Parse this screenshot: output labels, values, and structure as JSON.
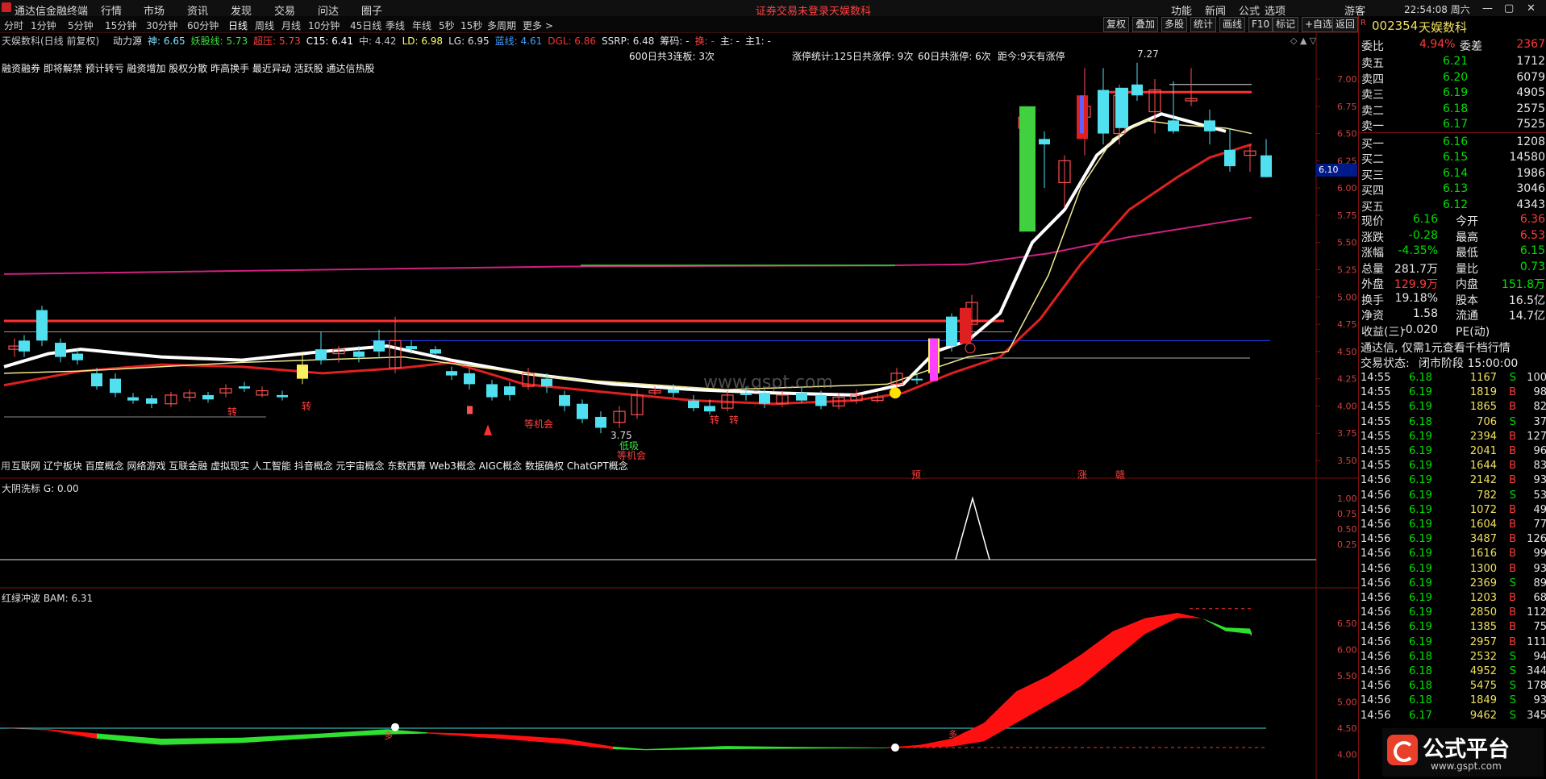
{
  "topbar": {
    "app_title": "通达信金融终端",
    "menu": [
      "行情",
      "市场",
      "资讯",
      "发现",
      "交易",
      "问达",
      "圈子"
    ],
    "status_notice": "证券交易未登录",
    "stock_name_top": "天娱数科",
    "right_menu": [
      "功能",
      "新闻",
      "公式",
      "选项"
    ],
    "user": "游客",
    "clock": "22:54:08 周六"
  },
  "periodbar": {
    "periods": [
      "分时",
      "1分钟",
      "5分钟",
      "15分钟",
      "30分钟",
      "60分钟",
      "日线",
      "周线",
      "月线",
      "10分钟",
      "45日线",
      "季线",
      "年线",
      "5秒",
      "15秒",
      "多周期",
      "更多 >"
    ],
    "active": "日线",
    "tools": [
      "复权",
      "叠加",
      "多股",
      "统计",
      "画线",
      "F10",
      "标记",
      "+自选",
      "返回"
    ]
  },
  "indicator_line": {
    "title": "天娱数科(日线 前复权)",
    "items": [
      {
        "text": "动力源",
        "color": "#e0e0e0"
      },
      {
        "text": "神: 6.65",
        "color": "#7fe0ff"
      },
      {
        "text": "妖股线: 5.73",
        "color": "#40e040"
      },
      {
        "text": "超压: 5.73",
        "color": "#ff4040"
      },
      {
        "text": "C15: 6.41",
        "color": "#ffffff"
      },
      {
        "text": "中: 4.42",
        "color": "#c0c0c0"
      },
      {
        "text": "LD: 6.98",
        "color": "#ffff60"
      },
      {
        "text": "LG: 6.95",
        "color": "#e0e0e0"
      },
      {
        "text": "蓝线: 4.61",
        "color": "#40a0ff"
      },
      {
        "text": "DGL: 6.86",
        "color": "#ff3030"
      },
      {
        "text": "SSRP: 6.48",
        "color": "#e0e0e0"
      },
      {
        "text": "筹码: -",
        "color": "#e0e0e0"
      },
      {
        "text": "换: -",
        "color": "#ff4040"
      },
      {
        "text": "主: -",
        "color": "#e0e0e0"
      },
      {
        "text": "主1: -",
        "color": "#e0e0e0"
      }
    ]
  },
  "tags_line": "融资融券 即将解禁 预计转亏 融资增加 股权分散 昨高换手 最近异动 活跃股 通达信热股",
  "concept_line": "互联网 辽宁板块 百度概念 网络游戏 互联金融 虚拟现实 人工智能 抖音概念 元宇宙概念 东数西算 Web3概念 AIGC概念 数据确权 ChatGPT概念",
  "concept_prefix": "用",
  "stats": {
    "s1": "600日共3连板: 3次",
    "s2": "涨停统计:125日共涨停: 9次",
    "s3": "60日共涨停: 6次",
    "s4": "距今:9天有涨停"
  },
  "main_chart": {
    "y_ticks": [
      "7.00",
      "6.75",
      "6.50",
      "6.25",
      "6.00",
      "5.75",
      "5.50",
      "5.25",
      "5.00",
      "4.75",
      "4.50",
      "4.25",
      "4.00",
      "3.75",
      "3.50"
    ],
    "price_box": "6.10",
    "high_label": "7.27",
    "low_label": "3.75",
    "annotations": {
      "zhuan": "转",
      "dengjihui": "等机会",
      "diqi": "低吸",
      "yu": "预",
      "zhang": "涨",
      "zhu": "赣"
    },
    "watermark": "www.gspt.com"
  },
  "panel2": {
    "title": "大阴洗标 G: 0.00",
    "y_ticks": [
      "1.00",
      "0.75",
      "0.50",
      "0.25"
    ]
  },
  "panel3": {
    "title": "红绿冲波 BAM: 6.31",
    "y_ticks": [
      "6.50",
      "6.00",
      "5.50",
      "5.00",
      "4.50",
      "4.00"
    ],
    "marker": "多"
  },
  "right": {
    "code": "002354",
    "name": "天娱数科",
    "weibi_label": "委比",
    "weibi": "4.94%",
    "weicha_label": "委差",
    "weicha": "2367",
    "sells": [
      {
        "label": "卖五",
        "price": "6.21",
        "vol": "1712"
      },
      {
        "label": "卖四",
        "price": "6.20",
        "vol": "6079"
      },
      {
        "label": "卖三",
        "price": "6.19",
        "vol": "4905"
      },
      {
        "label": "卖二",
        "price": "6.18",
        "vol": "2575"
      },
      {
        "label": "卖一",
        "price": "6.17",
        "vol": "7525"
      }
    ],
    "buys": [
      {
        "label": "买一",
        "price": "6.16",
        "vol": "1208"
      },
      {
        "label": "买二",
        "price": "6.15",
        "vol": "14580"
      },
      {
        "label": "买三",
        "price": "6.14",
        "vol": "1986"
      },
      {
        "label": "买四",
        "price": "6.13",
        "vol": "3046"
      },
      {
        "label": "买五",
        "price": "6.12",
        "vol": "4343"
      }
    ],
    "quotes": [
      {
        "l1": "现价",
        "v1": "6.16",
        "c1": "green",
        "l2": "今开",
        "v2": "6.36",
        "c2": "red"
      },
      {
        "l1": "涨跌",
        "v1": "-0.28",
        "c1": "green",
        "l2": "最高",
        "v2": "6.53",
        "c2": "red"
      },
      {
        "l1": "涨幅",
        "v1": "-4.35%",
        "c1": "green",
        "l2": "最低",
        "v2": "6.15",
        "c2": "green"
      },
      {
        "l1": "总量",
        "v1": "281.7万",
        "c1": "white",
        "l2": "量比",
        "v2": "0.73",
        "c2": "green"
      },
      {
        "l1": "外盘",
        "v1": "129.9万",
        "c1": "red",
        "l2": "内盘",
        "v2": "151.8万",
        "c2": "green"
      },
      {
        "l1": "换手",
        "v1": "19.18%",
        "c1": "white",
        "l2": "股本",
        "v2": "16.5亿",
        "c2": "white"
      },
      {
        "l1": "净资",
        "v1": "1.58",
        "c1": "white",
        "l2": "流通",
        "v2": "14.7亿",
        "c2": "white"
      },
      {
        "l1": "收益(三)",
        "v1": "-0.020",
        "c1": "white",
        "l2": "PE(动)",
        "v2": "",
        "c2": "white"
      }
    ],
    "notice": "通达信, 仅需1元查看千档行情",
    "trade_state_label": "交易状态:",
    "trade_state": "闭市阶段 15:00:00",
    "ticks": [
      {
        "t": "14:55",
        "p": "6.18",
        "v": "1167",
        "d": "S",
        "n": "100"
      },
      {
        "t": "14:55",
        "p": "6.19",
        "v": "1819",
        "d": "B",
        "n": "98"
      },
      {
        "t": "14:55",
        "p": "6.19",
        "v": "1865",
        "d": "B",
        "n": "82"
      },
      {
        "t": "14:55",
        "p": "6.18",
        "v": "706",
        "d": "S",
        "n": "37"
      },
      {
        "t": "14:55",
        "p": "6.19",
        "v": "2394",
        "d": "B",
        "n": "127"
      },
      {
        "t": "14:55",
        "p": "6.19",
        "v": "2041",
        "d": "B",
        "n": "96"
      },
      {
        "t": "14:55",
        "p": "6.19",
        "v": "1644",
        "d": "B",
        "n": "83"
      },
      {
        "t": "14:56",
        "p": "6.19",
        "v": "2142",
        "d": "B",
        "n": "93"
      },
      {
        "t": "14:56",
        "p": "6.19",
        "v": "782",
        "d": "S",
        "n": "53"
      },
      {
        "t": "14:56",
        "p": "6.19",
        "v": "1072",
        "d": "B",
        "n": "49"
      },
      {
        "t": "14:56",
        "p": "6.19",
        "v": "1604",
        "d": "B",
        "n": "77"
      },
      {
        "t": "14:56",
        "p": "6.19",
        "v": "3487",
        "d": "B",
        "n": "126"
      },
      {
        "t": "14:56",
        "p": "6.19",
        "v": "1616",
        "d": "B",
        "n": "99"
      },
      {
        "t": "14:56",
        "p": "6.19",
        "v": "1300",
        "d": "B",
        "n": "93"
      },
      {
        "t": "14:56",
        "p": "6.19",
        "v": "2369",
        "d": "S",
        "n": "89"
      },
      {
        "t": "14:56",
        "p": "6.19",
        "v": "1203",
        "d": "B",
        "n": "68"
      },
      {
        "t": "14:56",
        "p": "6.19",
        "v": "2850",
        "d": "B",
        "n": "112"
      },
      {
        "t": "14:56",
        "p": "6.19",
        "v": "1385",
        "d": "B",
        "n": "75"
      },
      {
        "t": "14:56",
        "p": "6.19",
        "v": "2957",
        "d": "B",
        "n": "111"
      },
      {
        "t": "14:56",
        "p": "6.18",
        "v": "2532",
        "d": "S",
        "n": "94"
      },
      {
        "t": "14:56",
        "p": "6.18",
        "v": "4952",
        "d": "S",
        "n": "344"
      },
      {
        "t": "14:56",
        "p": "6.18",
        "v": "5475",
        "d": "S",
        "n": "178"
      },
      {
        "t": "14:56",
        "p": "6.18",
        "v": "1849",
        "d": "S",
        "n": "93"
      },
      {
        "t": "14:56",
        "p": "6.17",
        "v": "9462",
        "d": "S",
        "n": "345"
      }
    ]
  },
  "footer_logo": {
    "text": "公式平台",
    "url": "www.gspt.com"
  }
}
